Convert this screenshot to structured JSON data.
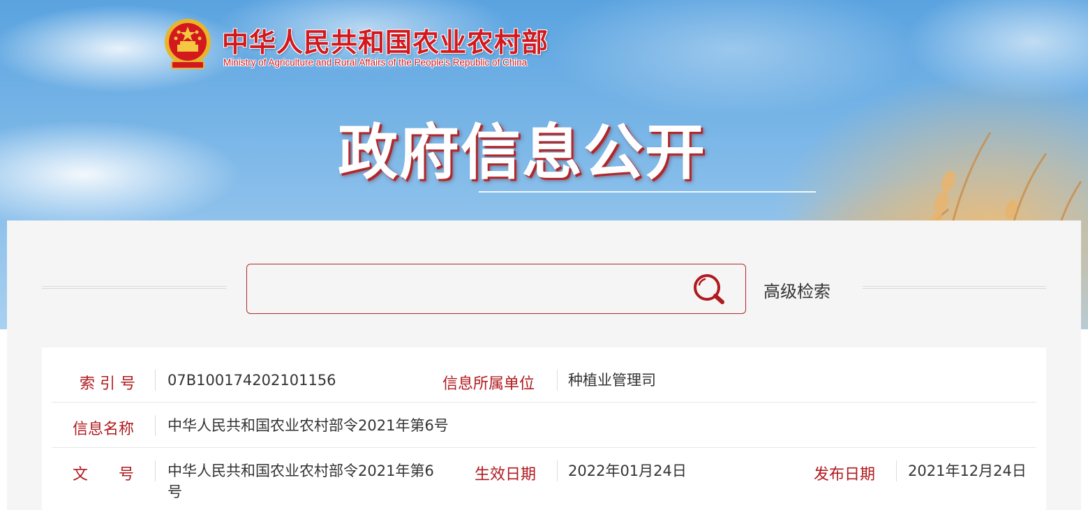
{
  "header": {
    "site_title_cn": "中华人民共和国农业农村部",
    "site_title_en": "Ministry of Agriculture and Rural Affairs of the People's Republic of China",
    "logo_icon": "national-emblem-icon",
    "section_title": "政府信息公开"
  },
  "search": {
    "placeholder": "",
    "value": "",
    "icon": "search-icon",
    "advanced_label": "高级检索"
  },
  "info": {
    "index_no_label": "索 引 号",
    "index_no_value": "07B100174202101156",
    "unit_label": "信息所属单位",
    "unit_value": "种植业管理司",
    "name_label": "信息名称",
    "name_value": "中华人民共和国农业农村部令2021年第6号",
    "doc_no_label": "文　　号",
    "doc_no_value": "中华人民共和国农业农村部令2021年第6号",
    "effective_label": "生效日期",
    "effective_value": "2022年01月24日",
    "publish_label": "发布日期",
    "publish_value": "2021年12月24日"
  },
  "colors": {
    "accent_red": "#b0191e",
    "title_red": "#d3181e",
    "panel_bg": "#f5f5f5"
  }
}
